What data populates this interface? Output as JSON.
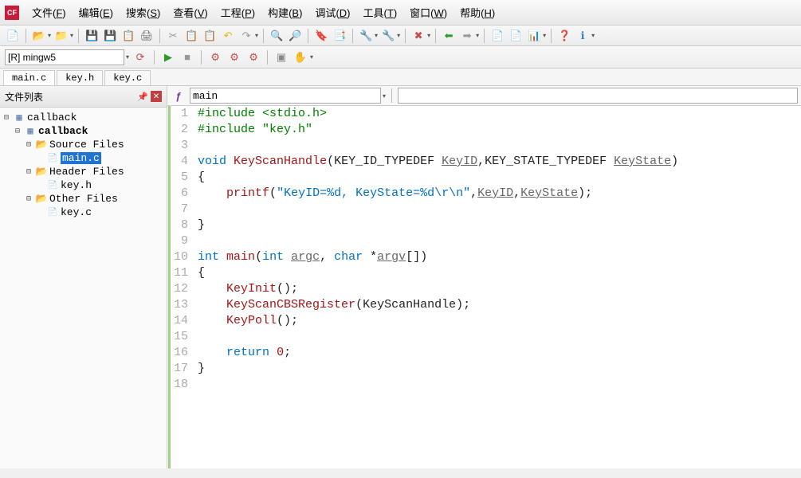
{
  "menu": {
    "items": [
      {
        "label": "文件",
        "key": "F"
      },
      {
        "label": "编辑",
        "key": "E"
      },
      {
        "label": "搜索",
        "key": "S"
      },
      {
        "label": "查看",
        "key": "V"
      },
      {
        "label": "工程",
        "key": "P"
      },
      {
        "label": "构建",
        "key": "B"
      },
      {
        "label": "调试",
        "key": "D"
      },
      {
        "label": "工具",
        "key": "T"
      },
      {
        "label": "窗口",
        "key": "W"
      },
      {
        "label": "帮助",
        "key": "H"
      }
    ]
  },
  "build_config": "[R] mingw5",
  "file_tabs": [
    {
      "name": "main.c",
      "active": true
    },
    {
      "name": "key.h",
      "active": false
    },
    {
      "name": "key.c",
      "active": false
    }
  ],
  "sidebar_title": "文件列表",
  "tree": {
    "root": "callback",
    "project": "callback",
    "folders": [
      {
        "name": "Source Files",
        "files": [
          "main.c"
        ],
        "highlight": "main.c"
      },
      {
        "name": "Header Files",
        "files": [
          "key.h"
        ]
      },
      {
        "name": "Other Files",
        "files": [
          "key.c"
        ]
      }
    ]
  },
  "symbol": "main",
  "code_lines": [
    {
      "n": 1,
      "html": "<span class='pp'>#include &lt;stdio.h&gt;</span>"
    },
    {
      "n": 2,
      "html": "<span class='pp'>#include \"key.h\"</span>"
    },
    {
      "n": 3,
      "html": ""
    },
    {
      "n": 4,
      "html": "<span class='kw'>void</span> <span class='fn'>KeyScanHandle</span>(KEY_ID_TYPEDEF <span class='ud'>KeyID</span>,KEY_STATE_TYPEDEF <span class='ud'>KeyState</span>)"
    },
    {
      "n": 5,
      "html": "{"
    },
    {
      "n": 6,
      "html": "    <span class='fn'>printf</span>(<span class='str'>\"KeyID=%d, KeyState=%d\\r\\n\"</span>,<span class='ud'>KeyID</span>,<span class='ud'>KeyState</span>);"
    },
    {
      "n": 7,
      "html": ""
    },
    {
      "n": 8,
      "html": "}"
    },
    {
      "n": 9,
      "html": ""
    },
    {
      "n": 10,
      "html": "<span class='kw'>int</span> <span class='fn'>main</span>(<span class='kw'>int</span> <span class='ud'>argc</span>, <span class='kw'>char</span> *<span class='ud'>argv</span>[])"
    },
    {
      "n": 11,
      "html": "{"
    },
    {
      "n": 12,
      "html": "    <span class='fn'>KeyInit</span>();"
    },
    {
      "n": 13,
      "html": "    <span class='fn'>KeyScanCBSRegister</span>(KeyScanHandle);"
    },
    {
      "n": 14,
      "html": "    <span class='fn'>KeyPoll</span>();"
    },
    {
      "n": 15,
      "html": ""
    },
    {
      "n": 16,
      "html": "    <span class='kw'>return</span> <span class='num'>0</span>;"
    },
    {
      "n": 17,
      "html": "}"
    },
    {
      "n": 18,
      "html": ""
    }
  ]
}
